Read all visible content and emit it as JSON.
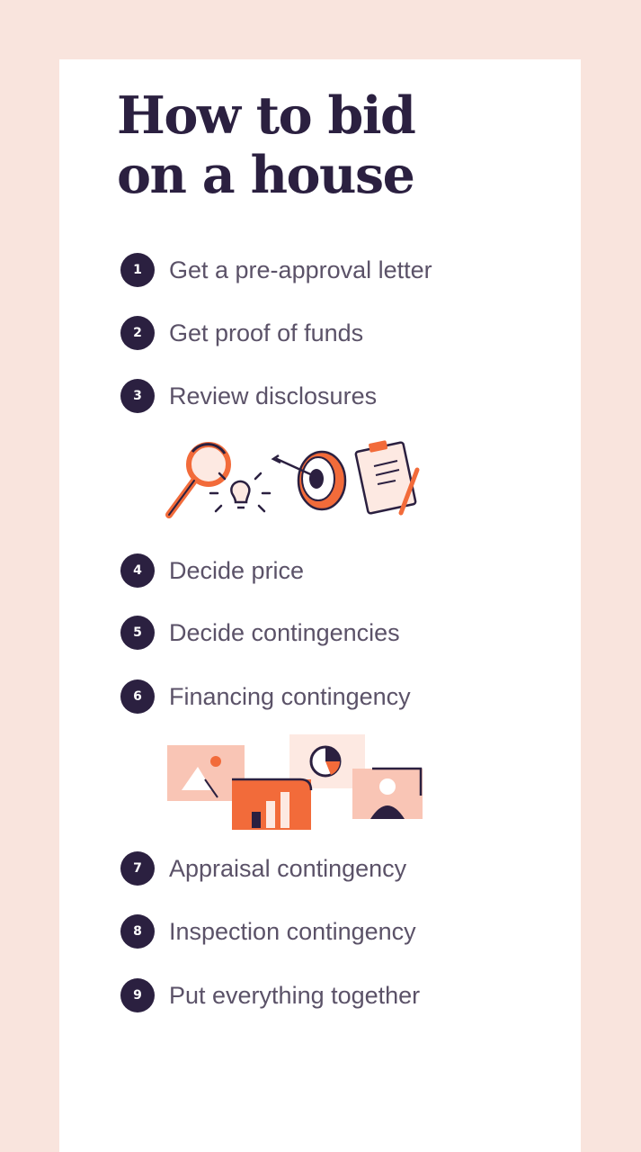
{
  "title": {
    "line1": "How to bid",
    "line2": "on a house"
  },
  "steps": [
    {
      "number": "1",
      "label": "Get a pre-approval letter"
    },
    {
      "number": "2",
      "label": "Get proof of funds"
    },
    {
      "number": "3",
      "label": "Review disclosures"
    },
    {
      "number": "4",
      "label": "Decide price"
    },
    {
      "number": "5",
      "label": "Decide contingencies"
    },
    {
      "number": "6",
      "label": "Financing contingency"
    },
    {
      "number": "7",
      "label": "Appraisal contingency"
    },
    {
      "number": "8",
      "label": "Inspection contingency"
    },
    {
      "number": "9",
      "label": "Put everything together"
    }
  ],
  "illustrations": [
    {
      "icons": [
        "magnifying-glass-icon",
        "lightbulb-icon",
        "target-icon",
        "clipboard-icon"
      ]
    },
    {
      "icons": [
        "image-card-icon",
        "bar-chart-card-icon",
        "pie-chart-card-icon",
        "profile-card-icon"
      ]
    }
  ],
  "colors": {
    "background": "#f9e4dd",
    "card": "#ffffff",
    "title": "#2b2040",
    "step_text": "#5b5268",
    "accent_orange": "#f26b3a",
    "accent_peach": "#f9c5b5"
  }
}
